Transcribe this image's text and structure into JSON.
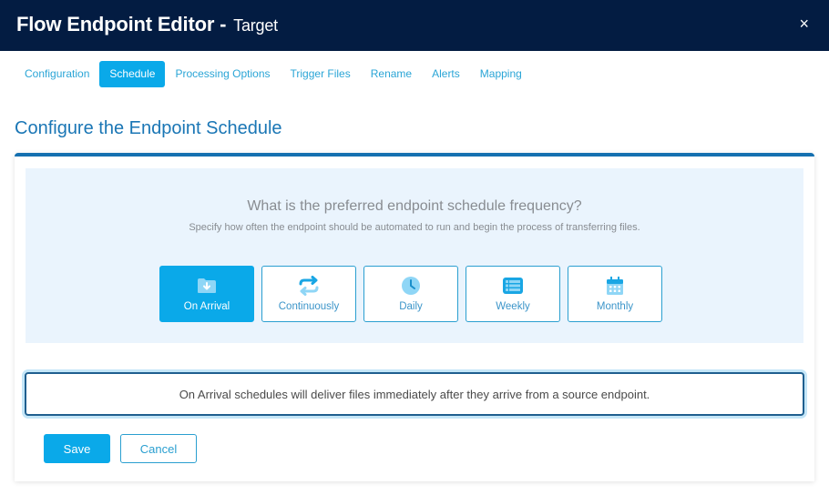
{
  "header": {
    "title": "Flow Endpoint Editor -",
    "subtitle": "Target",
    "close_label": "×"
  },
  "tabs": [
    {
      "label": "Configuration",
      "active": false
    },
    {
      "label": "Schedule",
      "active": true
    },
    {
      "label": "Processing Options",
      "active": false
    },
    {
      "label": "Trigger Files",
      "active": false
    },
    {
      "label": "Rename",
      "active": false
    },
    {
      "label": "Alerts",
      "active": false
    },
    {
      "label": "Mapping",
      "active": false
    }
  ],
  "page_title": "Configure the Endpoint Schedule",
  "schedule": {
    "question": "What is the preferred endpoint schedule frequency?",
    "description": "Specify how often the endpoint should be automated to run and begin the process of transferring files.",
    "options": [
      {
        "label": "On Arrival",
        "icon": "folder-download-icon",
        "selected": true
      },
      {
        "label": "Continuously",
        "icon": "repeat-icon",
        "selected": false
      },
      {
        "label": "Daily",
        "icon": "clock-icon",
        "selected": false
      },
      {
        "label": "Weekly",
        "icon": "list-icon",
        "selected": false
      },
      {
        "label": "Monthly",
        "icon": "calendar-icon",
        "selected": false
      }
    ],
    "info_text": "On Arrival schedules will deliver files immediately after they arrive from a source endpoint."
  },
  "actions": {
    "save_label": "Save",
    "cancel_label": "Cancel"
  },
  "colors": {
    "header_bg": "#031c42",
    "accent": "#0aa9e9",
    "title_blue": "#1a76b5"
  }
}
